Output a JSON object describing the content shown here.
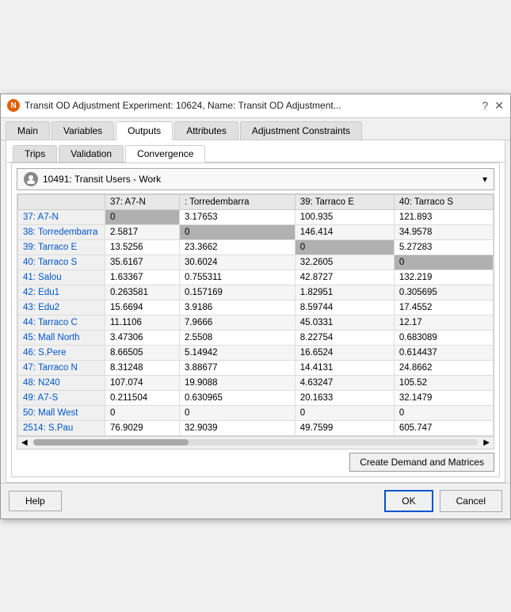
{
  "window": {
    "title": "Transit OD Adjustment Experiment: 10624, Name: Transit OD Adjustment...",
    "icon": "N"
  },
  "main_tabs": [
    {
      "label": "Main",
      "active": false
    },
    {
      "label": "Variables",
      "active": false
    },
    {
      "label": "Outputs",
      "active": true
    },
    {
      "label": "Attributes",
      "active": false
    },
    {
      "label": "Adjustment Constraints",
      "active": false
    }
  ],
  "sub_tabs": [
    {
      "label": "Trips",
      "active": false
    },
    {
      "label": "Validation",
      "active": false
    },
    {
      "label": "Convergence",
      "active": true
    }
  ],
  "dropdown": {
    "label": "10491: Transit Users - Work"
  },
  "table": {
    "col_headers": [
      "",
      "37: A7-N",
      ": Torredembarra",
      "39: Tarraco E",
      "40: Tarraco S"
    ],
    "rows": [
      {
        "label": "37: A7-N",
        "c1": "0",
        "c2": "3.17653",
        "c3": "100.935",
        "c4": "121.893",
        "diag": 0
      },
      {
        "label": "38: Torredembarra",
        "c1": "2.5817",
        "c2": "0",
        "c3": "146.414",
        "c4": "34.9578",
        "diag": 1
      },
      {
        "label": "39: Tarraco E",
        "c1": "13.5256",
        "c2": "23.3662",
        "c3": "0",
        "c4": "5.27283",
        "diag": 2
      },
      {
        "label": "40: Tarraco S",
        "c1": "35.6167",
        "c2": "30.6024",
        "c3": "32.2605",
        "c4": "0",
        "diag": 3
      },
      {
        "label": "41: Salou",
        "c1": "1.63367",
        "c2": "0.755311",
        "c3": "42.8727",
        "c4": "132.219",
        "diag": -1
      },
      {
        "label": "42: Edu1",
        "c1": "0.263581",
        "c2": "0.157169",
        "c3": "1.82951",
        "c4": "0.305695",
        "diag": -1
      },
      {
        "label": "43: Edu2",
        "c1": "15.6694",
        "c2": "3.9186",
        "c3": "8.59744",
        "c4": "17.4552",
        "diag": -1
      },
      {
        "label": "44: Tarraco C",
        "c1": "11.1106",
        "c2": "7.9666",
        "c3": "45.0331",
        "c4": "12.17",
        "diag": -1
      },
      {
        "label": "45: Mall North",
        "c1": "3.47306",
        "c2": "2.5508",
        "c3": "8.22754",
        "c4": "0.683089",
        "diag": -1
      },
      {
        "label": "46: S.Pere",
        "c1": "8.66505",
        "c2": "5.14942",
        "c3": "16.6524",
        "c4": "0.614437",
        "diag": -1
      },
      {
        "label": "47: Tarraco N",
        "c1": "8.31248",
        "c2": "3.88677",
        "c3": "14.4131",
        "c4": "24.8662",
        "diag": -1
      },
      {
        "label": "48: N240",
        "c1": "107.074",
        "c2": "19.9088",
        "c3": "4.63247",
        "c4": "105.52",
        "diag": -1
      },
      {
        "label": "49: A7-S",
        "c1": "0.211504",
        "c2": "0.630965",
        "c3": "20.1633",
        "c4": "32.1479",
        "diag": -1
      },
      {
        "label": "50: Mall West",
        "c1": "0",
        "c2": "0",
        "c3": "0",
        "c4": "0",
        "diag": -1
      },
      {
        "label": "2514: S.Pau",
        "c1": "76.9029",
        "c2": "32.9039",
        "c3": "49.7599",
        "c4": "605.747",
        "diag": -1
      }
    ]
  },
  "buttons": {
    "create_demand": "Create Demand and Matrices",
    "help": "Help",
    "ok": "OK",
    "cancel": "Cancel"
  }
}
